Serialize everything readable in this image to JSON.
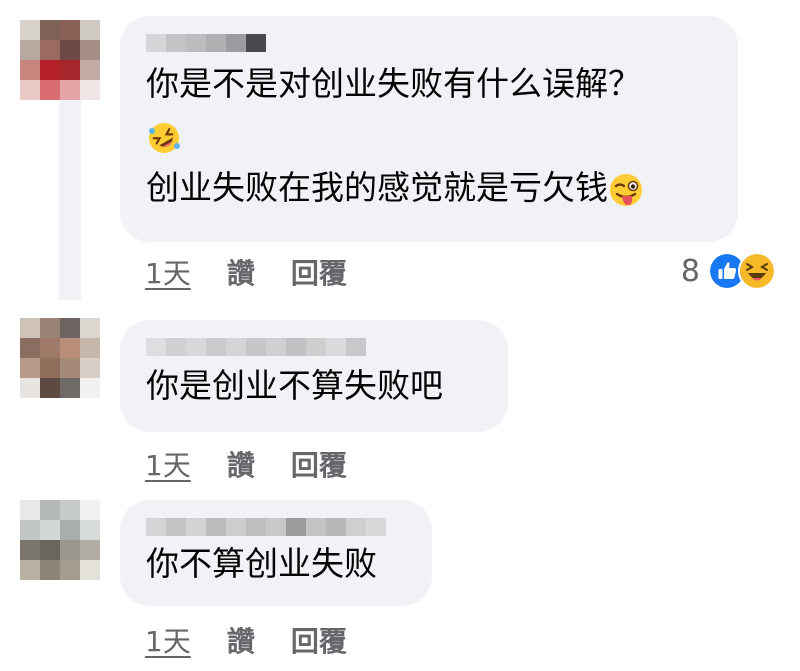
{
  "comments": [
    {
      "lines": [
        "你是不是对创业失败有什么误解？",
        "",
        "创业失败在我的感觉就是亏欠钱"
      ],
      "emojis": [
        "rolling-on-floor-laughing-emoji",
        "winking-face-with-tongue-emoji"
      ],
      "time": "1天",
      "like": "讚",
      "reply": "回覆",
      "reaction_count": "8",
      "reactions": [
        "like-reaction-icon",
        "haha-reaction-icon"
      ]
    },
    {
      "lines": [
        "你是创业不算失败吧"
      ],
      "time": "1天",
      "like": "讚",
      "reply": "回覆"
    },
    {
      "lines": [
        "你不算创业失败"
      ],
      "time": "1天",
      "like": "讚",
      "reply": "回覆"
    }
  ],
  "colors": {
    "bubble": "#f0f2f5",
    "text": "#050505",
    "secondary": "#65676b",
    "like_blue": "#1877f2",
    "haha_yellow": "#f7b928"
  }
}
